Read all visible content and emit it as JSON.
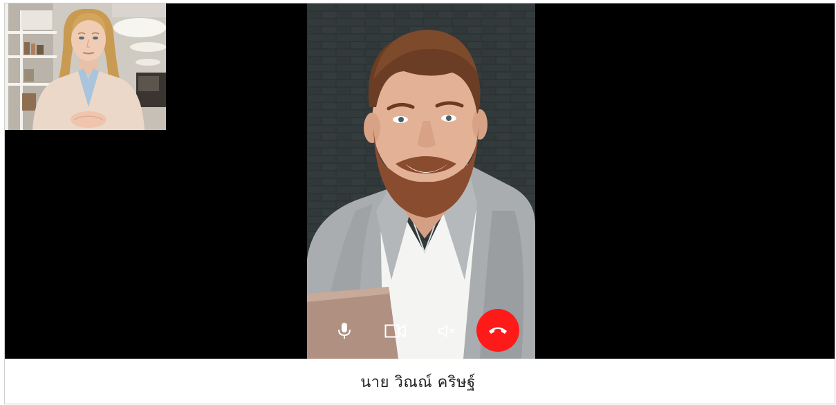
{
  "call": {
    "caller_name": "นาย วิณณ์ คริษฐ์"
  },
  "controls": {
    "mic_icon": "microphone-icon",
    "camera_icon": "video-camera-icon",
    "speaker_icon": "speaker-muted-icon",
    "end_call_icon": "phone-hangup-icon"
  },
  "colors": {
    "end_call": "#ff1a1a",
    "stage_background": "#000000",
    "controls_icon": "#ffffff"
  }
}
